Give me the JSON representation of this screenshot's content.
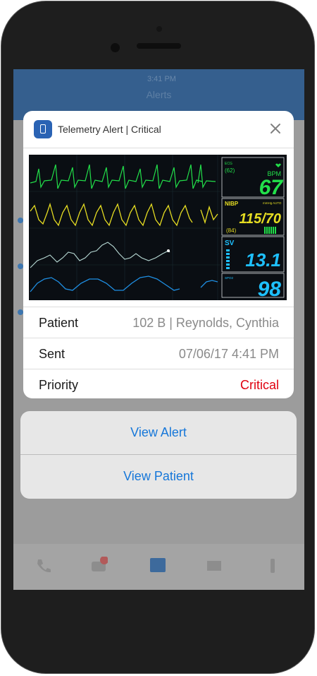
{
  "background": {
    "status_time": "3:41 PM",
    "header_title": "Alerts"
  },
  "notification": {
    "app_icon": "phone-icon",
    "title": "Telemetry Alert | Critical",
    "close_icon": "close-icon",
    "monitor": {
      "ecg_label": "ECG",
      "hr_small": "(62)",
      "bpm_label": "BPM",
      "heart_rate": "67",
      "nibp_label": "NIBP",
      "nibp_unit": "mmHg",
      "nibp_mode": "AUTO",
      "blood_pressure": "115/70",
      "pr_small": "(84)",
      "sv_label": "SV",
      "stroke_volume": "13.1",
      "spo2_label": "SPO2",
      "spo2": "98"
    },
    "rows": [
      {
        "label": "Patient",
        "value": "102 B | Reynolds, Cynthia"
      },
      {
        "label": "Sent",
        "value": "07/06/17 4:41 PM"
      },
      {
        "label": "Priority",
        "value": "Critical"
      }
    ],
    "priority_color": "#e0000f"
  },
  "actions": [
    {
      "label": "View Alert"
    },
    {
      "label": "View Patient"
    }
  ],
  "colors": {
    "accent": "#1677d9",
    "app_icon_bg": "#2a63b4",
    "ecg": "#22e04a",
    "nibp": "#f2e600",
    "sv": "#1ec0ff"
  }
}
